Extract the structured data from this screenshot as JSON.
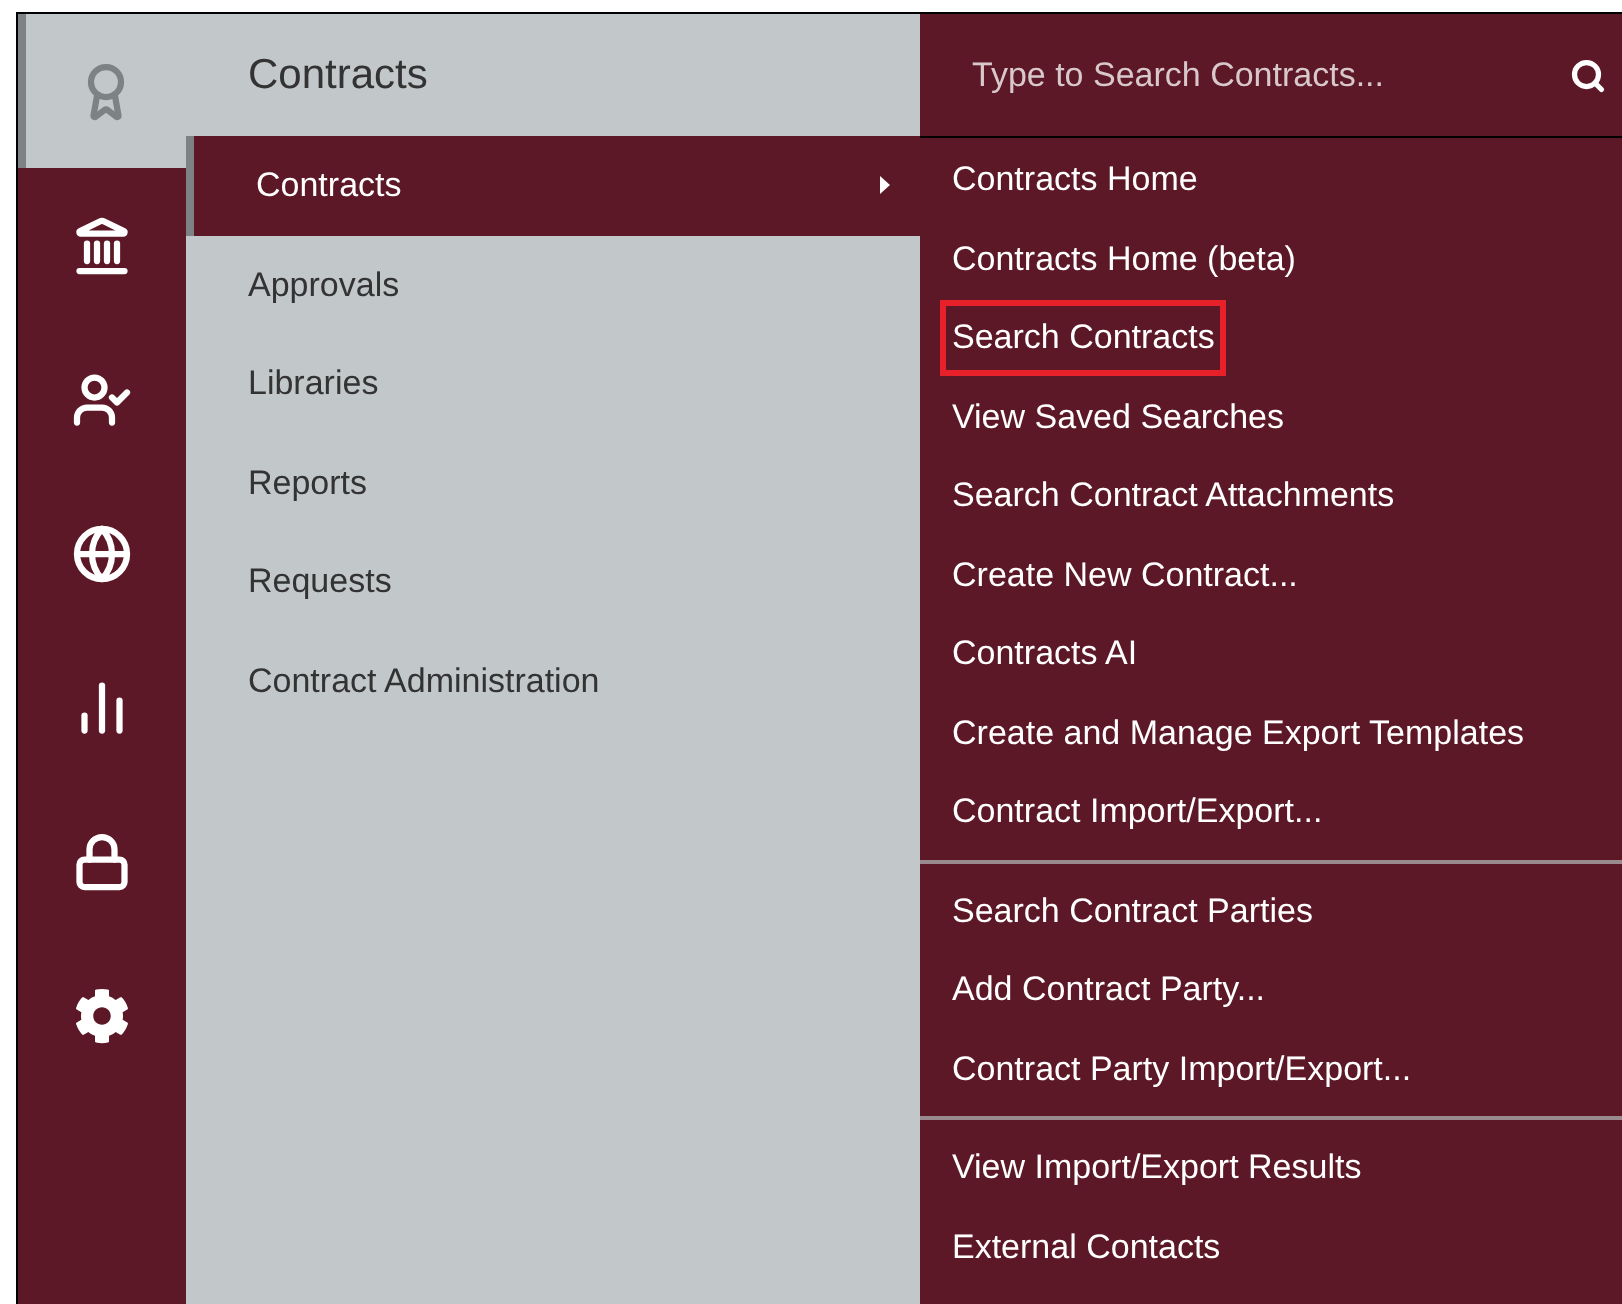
{
  "rail": [
    {
      "kind": "award",
      "selected": true
    },
    {
      "kind": "bank",
      "selected": false
    },
    {
      "kind": "users",
      "selected": false
    },
    {
      "kind": "globe",
      "selected": false
    },
    {
      "kind": "chart",
      "selected": false
    },
    {
      "kind": "lock",
      "selected": false
    },
    {
      "kind": "gear",
      "selected": false
    }
  ],
  "menu": {
    "title": "Contracts",
    "items": [
      {
        "label": "Contracts",
        "selected": true
      },
      {
        "label": "Approvals",
        "selected": false
      },
      {
        "label": "Libraries",
        "selected": false
      },
      {
        "label": "Reports",
        "selected": false
      },
      {
        "label": "Requests",
        "selected": false
      },
      {
        "label": "Contract Administration",
        "selected": false
      }
    ]
  },
  "submenu": {
    "search": {
      "placeholder": "Type to Search Contracts..."
    },
    "groups": [
      [
        {
          "label": "Contracts Home",
          "highlighted": false
        },
        {
          "label": "Contracts Home (beta)",
          "highlighted": false
        },
        {
          "label": "Search Contracts",
          "highlighted": true
        },
        {
          "label": "View Saved Searches",
          "highlighted": false
        },
        {
          "label": "Search Contract Attachments",
          "highlighted": false
        },
        {
          "label": "Create New Contract...",
          "highlighted": false
        },
        {
          "label": "Contracts AI",
          "highlighted": false
        },
        {
          "label": "Create and Manage Export Templates",
          "highlighted": false
        },
        {
          "label": "Contract Import/Export...",
          "highlighted": false
        }
      ],
      [
        {
          "label": "Search Contract Parties",
          "highlighted": false
        },
        {
          "label": "Add Contract Party...",
          "highlighted": false
        },
        {
          "label": "Contract Party Import/Export...",
          "highlighted": false
        }
      ],
      [
        {
          "label": "View Import/Export Results",
          "highlighted": false
        },
        {
          "label": "External Contacts",
          "highlighted": false
        }
      ]
    ]
  }
}
